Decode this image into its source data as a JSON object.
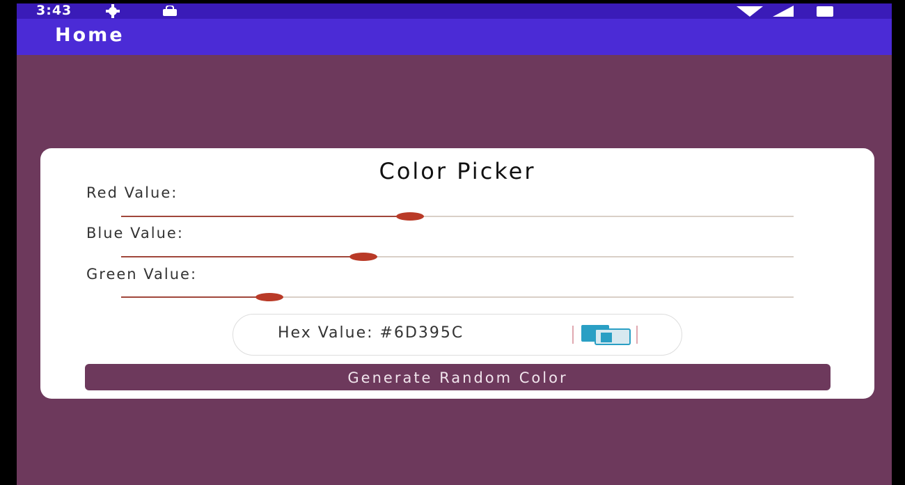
{
  "status_bar": {
    "time": "3:43",
    "icons": [
      "gear-icon",
      "lock-icon",
      "wifi-icon",
      "signal-icon",
      "battery-icon"
    ]
  },
  "app_bar": {
    "title": "Home"
  },
  "card": {
    "title": "Color Picker",
    "sliders": [
      {
        "label": "Red Value:",
        "value": 0.43
      },
      {
        "label": "Blue Value:",
        "value": 0.36
      },
      {
        "label": "Green Value:",
        "value": 0.22
      }
    ],
    "hex_value": "Hex Value: #6D395C",
    "button_label": "Generate Random Color"
  },
  "colors": {
    "background": "#6d395c",
    "status_bar": "#3a1bb8",
    "app_bar": "#4b2bd6",
    "slider_thumb": "#b93a27",
    "copy_icon": "#2a9fc4"
  }
}
